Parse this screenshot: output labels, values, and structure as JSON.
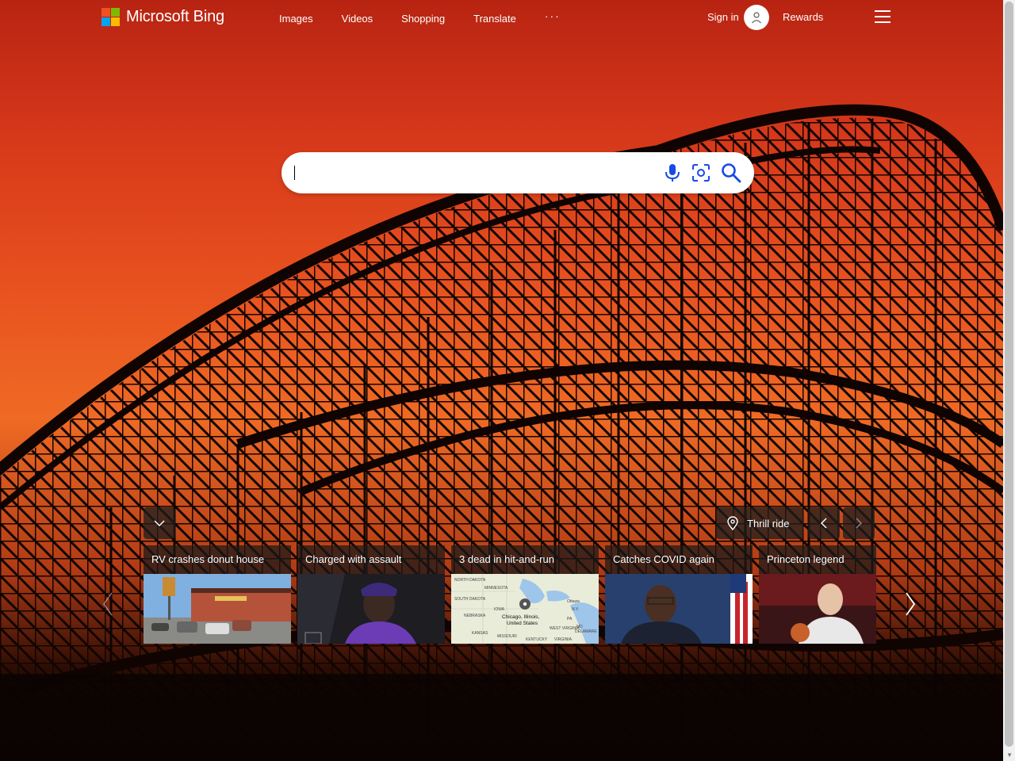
{
  "brand": {
    "name": "Microsoft Bing",
    "colors": [
      "#f25022",
      "#7fba00",
      "#00a4ef",
      "#ffb900"
    ]
  },
  "nav": {
    "items": [
      "Images",
      "Videos",
      "Shopping",
      "Translate"
    ],
    "more": "···"
  },
  "account": {
    "signin": "Sign in",
    "rewards": "Rewards"
  },
  "search": {
    "value": "",
    "icons": [
      "microphone-icon",
      "visual-search-icon",
      "search-icon"
    ]
  },
  "location": {
    "label": "Thrill ride"
  },
  "news": [
    {
      "title": "RV crashes donut house"
    },
    {
      "title": "Charged with assault"
    },
    {
      "title": "3 dead in hit-and-run",
      "map_labels": [
        "NORTH DAKOTA",
        "SOUTH DAKOTA",
        "MINNESOTA",
        "NEBRASKA",
        "IOWA",
        "KANSAS",
        "MISSOURI",
        "KENTUCKY",
        "VIRGINIA",
        "Ottawa",
        "N.Y.",
        "PA",
        "MD",
        "DELAWARE",
        "WEST VIRGINIA",
        "Chicago, Illinois,",
        "United States"
      ]
    },
    {
      "title": "Catches COVID again"
    },
    {
      "title": "Princeton legend"
    }
  ]
}
